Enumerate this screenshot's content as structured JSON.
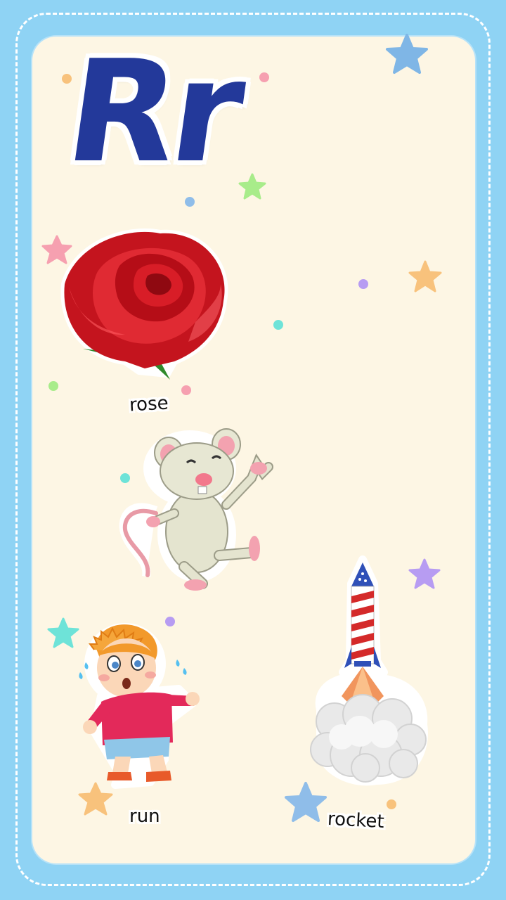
{
  "letter": "Rr",
  "words": {
    "rose": "rose",
    "run": "run",
    "rocket": "rocket"
  },
  "colors": {
    "background": "#8fd3f4",
    "card": "#fdf6e4",
    "letter": "#23399a"
  }
}
